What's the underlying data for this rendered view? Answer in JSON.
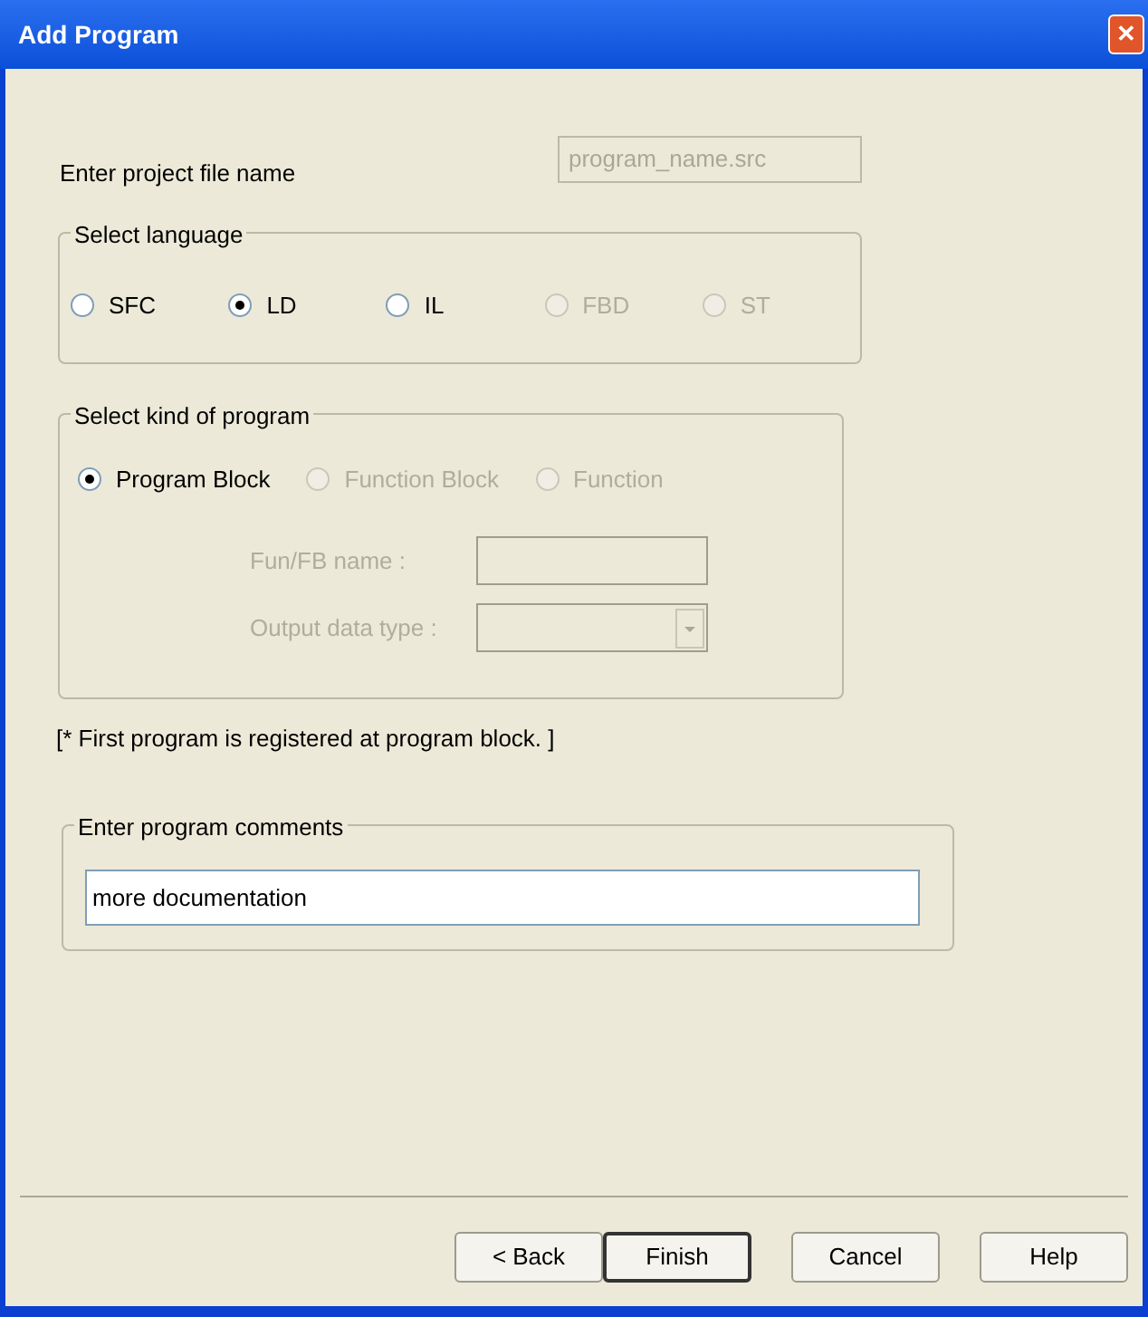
{
  "window": {
    "title": "Add Program",
    "close": "✕"
  },
  "file_name": {
    "label": "Enter project file name",
    "value": "program_name.src",
    "disabled": true
  },
  "language": {
    "title": "Select language",
    "options": [
      {
        "label": "SFC",
        "selected": false,
        "disabled": false
      },
      {
        "label": "LD",
        "selected": true,
        "disabled": false
      },
      {
        "label": "IL",
        "selected": false,
        "disabled": false
      },
      {
        "label": "FBD",
        "selected": false,
        "disabled": true
      },
      {
        "label": "ST",
        "selected": false,
        "disabled": true
      }
    ]
  },
  "kind": {
    "title": "Select kind of program",
    "options": [
      {
        "label": "Program Block",
        "selected": true,
        "disabled": false
      },
      {
        "label": "Function Block",
        "selected": false,
        "disabled": true
      },
      {
        "label": "Function",
        "selected": false,
        "disabled": true
      }
    ],
    "fb_name": {
      "label": "Fun/FB name :",
      "disabled": true
    },
    "output_type": {
      "label": "Output data type :",
      "disabled": true
    }
  },
  "note": "[* First program is registered at program block. ]",
  "comments": {
    "title": "Enter program comments",
    "value": "more documentation"
  },
  "buttons": [
    {
      "label": "< Back",
      "default": false
    },
    {
      "label": "Finish",
      "default": true
    },
    {
      "label": "Cancel",
      "default": false
    },
    {
      "label": "Help",
      "default": false
    }
  ]
}
